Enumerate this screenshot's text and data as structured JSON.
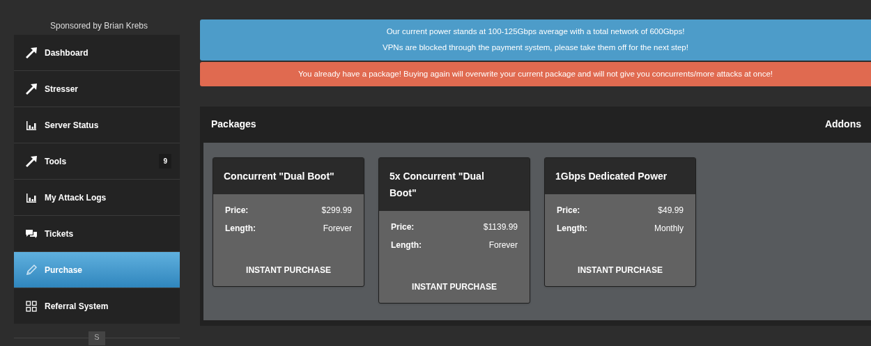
{
  "sidebar": {
    "sponsor": "Sponsored by Brian Krebs",
    "items": [
      {
        "kind": "arrow",
        "label": "Dashboard",
        "selected": false
      },
      {
        "kind": "arrow",
        "label": "Stresser",
        "selected": false
      },
      {
        "kind": "chart",
        "label": "Server Status",
        "selected": false
      },
      {
        "kind": "arrow",
        "label": "Tools",
        "selected": false,
        "badge": "9"
      },
      {
        "kind": "chart",
        "label": "My Attack Logs",
        "selected": false
      },
      {
        "kind": "chat",
        "label": "Tickets",
        "selected": false
      },
      {
        "kind": "pencil",
        "label": "Purchase",
        "selected": true
      },
      {
        "kind": "grid",
        "label": "Referral System",
        "selected": false
      }
    ],
    "toggle": "S"
  },
  "alerts": [
    {
      "kind": "info",
      "lines": [
        "Our current power stands at 100-125Gbps average with a total network of 600Gbps!",
        "VPNs are blocked through the payment system, please take them off for the next step!"
      ]
    },
    {
      "kind": "danger",
      "lines": [
        "You already have a package! Buying again will overwrite your current package and will not give you concurrents/more attacks at once!"
      ]
    }
  ],
  "panel": {
    "title": "Packages",
    "addons": "Addons",
    "packages": [
      {
        "name": "Concurrent \"Dual Boot\"",
        "fields": [
          {
            "label": "Price:",
            "value": "$299.99"
          },
          {
            "label": "Length:",
            "value": "Forever"
          }
        ],
        "button": "INSTANT PURCHASE"
      },
      {
        "name": "5x Concurrent \"Dual Boot\"",
        "fields": [
          {
            "label": "Price:",
            "value": "$1139.99"
          },
          {
            "label": "Length:",
            "value": "Forever"
          }
        ],
        "button": "INSTANT PURCHASE"
      },
      {
        "name": "1Gbps Dedicated Power",
        "fields": [
          {
            "label": "Price:",
            "value": "$49.99"
          },
          {
            "label": "Length:",
            "value": "Monthly"
          }
        ],
        "button": "INSTANT PURCHASE"
      }
    ]
  }
}
